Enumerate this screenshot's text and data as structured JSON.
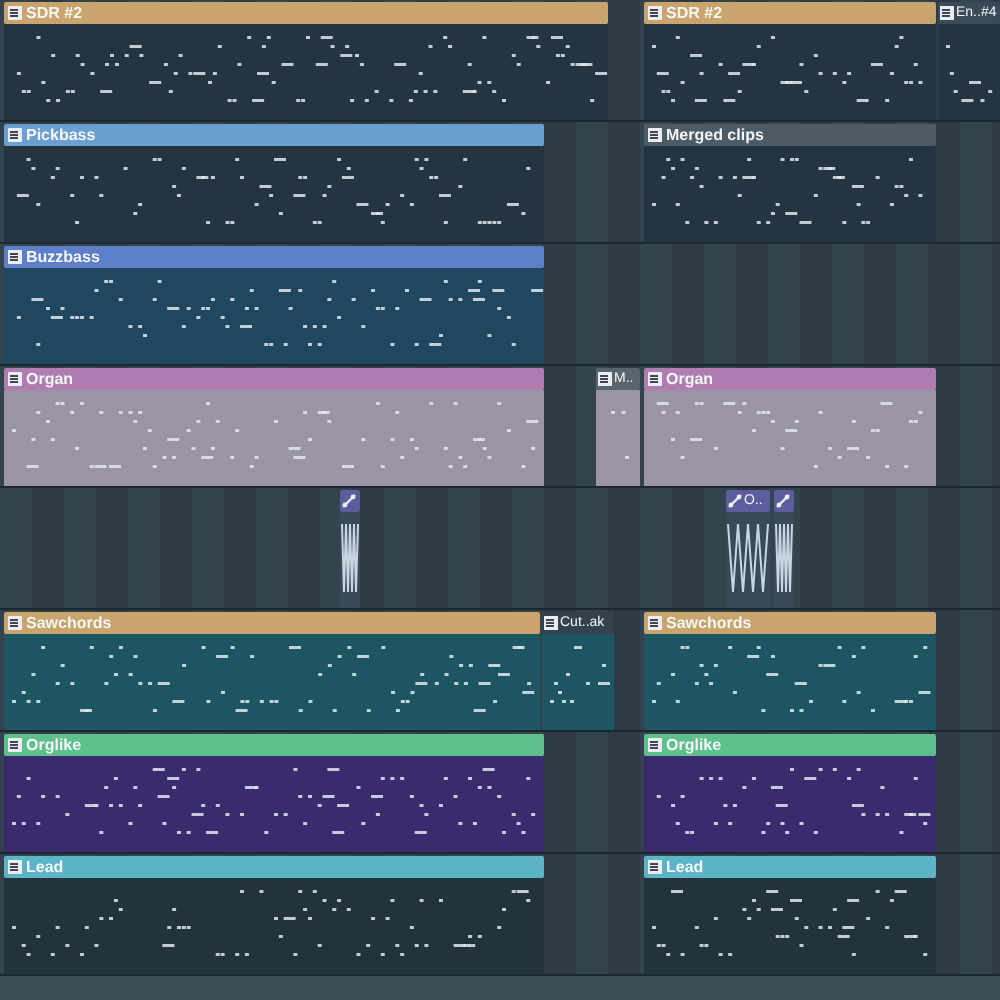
{
  "tracks": [
    {
      "color": "#243440",
      "clips": [
        {
          "kind": "pattern",
          "label": "SDR #2",
          "color": "#c9a46c"
        },
        {
          "kind": "pattern",
          "label": "SDR #2",
          "color": "#c9a46c"
        },
        {
          "kind": "pattern",
          "label": "En..#4",
          "color": "#3a4a56"
        }
      ]
    },
    {
      "color": "#243440",
      "clips": [
        {
          "kind": "pattern",
          "label": "Pickbass",
          "color": "#6b9fcf"
        },
        {
          "kind": "pattern",
          "label": "Merged clips",
          "color": "#4d5b67"
        }
      ]
    },
    {
      "color": "#1f4760",
      "clips": [
        {
          "kind": "pattern",
          "label": "Buzzbass",
          "color": "#5d7fca"
        }
      ]
    },
    {
      "color": "#9a94a4",
      "clips": [
        {
          "kind": "pattern",
          "label": "Organ",
          "color": "#b07cb2"
        },
        {
          "kind": "pattern",
          "label": "M..",
          "color": "#56656f"
        },
        {
          "kind": "pattern",
          "label": "Organ",
          "color": "#b07cb2"
        }
      ]
    },
    {
      "color": "#3a4956",
      "clips": [
        {
          "kind": "automation",
          "color": "#5d5c9c"
        },
        {
          "kind": "automation",
          "label": "O..",
          "color": "#5d5c9c"
        },
        {
          "kind": "automation",
          "color": "#5d5c9c"
        }
      ]
    },
    {
      "color": "#1d5662",
      "clips": [
        {
          "kind": "pattern",
          "label": "Sawchords",
          "color": "#c9a46c"
        },
        {
          "kind": "pattern",
          "label": "Cut..ak",
          "color": "#33424d"
        },
        {
          "kind": "pattern",
          "label": "Sawchords",
          "color": "#c9a46c"
        }
      ]
    },
    {
      "color": "#3a2b6e",
      "clips": [
        {
          "kind": "pattern",
          "label": "Orglike",
          "color": "#5ec08b"
        },
        {
          "kind": "pattern",
          "label": "Orglike",
          "color": "#5ec08b"
        }
      ]
    },
    {
      "color": "#22333e",
      "clips": [
        {
          "kind": "pattern",
          "label": "Lead",
          "color": "#5cb5c6"
        },
        {
          "kind": "pattern",
          "label": "Lead",
          "color": "#5cb5c6"
        }
      ]
    }
  ]
}
